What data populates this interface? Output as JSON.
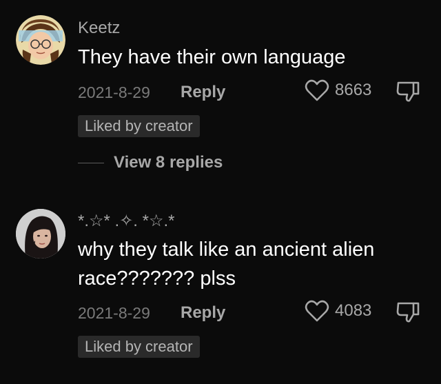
{
  "comments": [
    {
      "username": "Keetz",
      "text": "They have their own language",
      "date": "2021-8-29",
      "reply_label": "Reply",
      "likes": "8663",
      "badge": "Liked by creator",
      "view_replies": "View 8 replies",
      "avatar_icon": "cartoon-avatar"
    },
    {
      "username": "*.☆* .✧. *☆.*",
      "text_line1": "why they talk like an ancient alien",
      "text_line2": "race??????? plss",
      "date": "2021-8-29",
      "reply_label": "Reply",
      "likes": "4083",
      "badge": "Liked by creator",
      "avatar_icon": "photo-avatar"
    }
  ],
  "colors": {
    "background": "#0b0b0b",
    "primary_text": "#ffffff",
    "secondary_text": "#a8a8a8",
    "badge_bg": "#2a2a2a"
  }
}
